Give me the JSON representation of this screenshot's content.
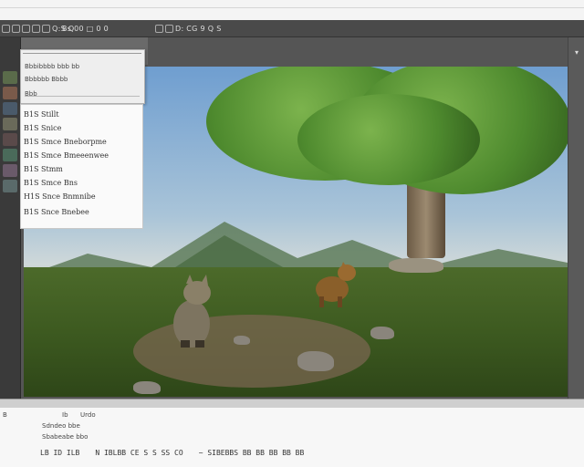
{
  "toolbar": {
    "left_text": "Q:S Q",
    "mid_text": "Bs 00 □ 0 0",
    "center_text": "D: CG 9 Q S"
  },
  "dropdown": {
    "row1": "Bbbibbbb bbb bb",
    "row2": "Bbbbbb Bbbb",
    "row3": "Bbb"
  },
  "list": {
    "items": [
      "B1S Stillt",
      "B1S Snice",
      "B1S Smce Bneborpme",
      "B1S Smce Bmeeenwee",
      "B1S Stmm",
      "B1S Smce Bns",
      "H1S Snce Bnmnibe",
      "B1S Snce Bnebee"
    ]
  },
  "bottom": {
    "line0_left": "B",
    "line0_a": "Ib",
    "line0_b": "Urdo",
    "line1": "Sdndeo bbe",
    "line2": "Sbabeabe bbo",
    "tools_left": "LB ID ILB",
    "tools_mid": "N IBLBB CE S S SS CO",
    "tools_right": "~ SIBEBBS BB BB BB BB BB"
  },
  "colors": {
    "toolbar_bg": "#4a4a4a",
    "workspace_bg": "#555555",
    "panel_bg": "#f7f7f7"
  }
}
